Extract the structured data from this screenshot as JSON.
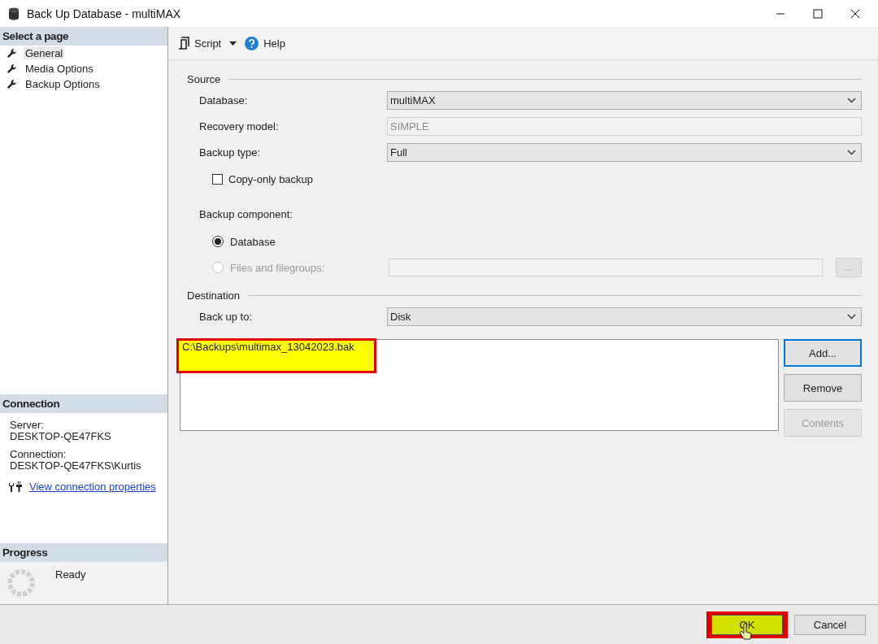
{
  "window": {
    "title": "Back Up Database - multiMAX"
  },
  "sidebar": {
    "select_page": {
      "header": "Select a page",
      "pages": [
        {
          "label": "General",
          "selected": true
        },
        {
          "label": "Media Options",
          "selected": false
        },
        {
          "label": "Backup Options",
          "selected": false
        }
      ]
    },
    "connection": {
      "header": "Connection",
      "server_label": "Server:",
      "server": "DESKTOP-QE47FKS",
      "connection_label": "Connection:",
      "connection": "DESKTOP-QE47FKS\\Kurtis",
      "link": "View connection properties"
    },
    "progress": {
      "header": "Progress",
      "status": "Ready"
    }
  },
  "toolbar": {
    "script": "Script",
    "help": "Help"
  },
  "source": {
    "title": "Source",
    "database": {
      "label": "Database:",
      "value": "multiMAX"
    },
    "recovery_model": {
      "label": "Recovery model:",
      "value": "SIMPLE"
    },
    "backup_type": {
      "label": "Backup type:",
      "value": "Full"
    },
    "copy_only": {
      "label": "Copy-only backup",
      "checked": false
    },
    "component": {
      "label": "Backup component:",
      "options": [
        {
          "label": "Database",
          "selected": true,
          "disabled": false
        },
        {
          "label": "Files and filegroups:",
          "selected": false,
          "disabled": true
        }
      ]
    },
    "browse": "..."
  },
  "destination": {
    "title": "Destination",
    "back_up_to": {
      "label": "Back up to:",
      "value": "Disk"
    },
    "files": [
      {
        "path": "C:\\Backups\\multimax_13042023.bak",
        "highlighted": true
      }
    ],
    "buttons": [
      {
        "label": "Add...",
        "disabled": false,
        "focused": true
      },
      {
        "label": "Remove",
        "disabled": false,
        "focused": false
      },
      {
        "label": "Contents",
        "disabled": true,
        "focused": false
      }
    ]
  },
  "footer": {
    "buttons": [
      {
        "label": "OK",
        "highlighted": true
      },
      {
        "label": "Cancel",
        "highlighted": false
      }
    ]
  }
}
